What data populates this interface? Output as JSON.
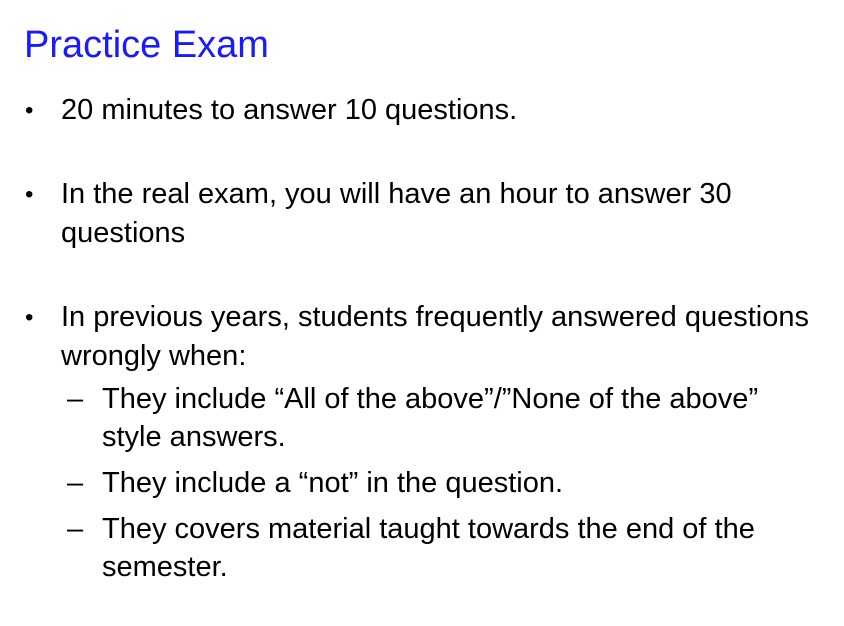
{
  "slide": {
    "title": "Practice Exam",
    "title_color": "#1a1aff",
    "bullet_symbol": "•",
    "dash_symbol": "–",
    "bullets": [
      {
        "text": "20 minutes to answer 10 questions."
      },
      {
        "text": "In the real exam, you will have an hour to answer 30 questions"
      },
      {
        "text": "In previous years, students frequently answered questions wrongly when:",
        "subs": [
          "They include “All of the above”/”None of the above” style answers.",
          "They include a “not” in the question.",
          "They covers material taught towards the end of the semester."
        ]
      }
    ]
  }
}
